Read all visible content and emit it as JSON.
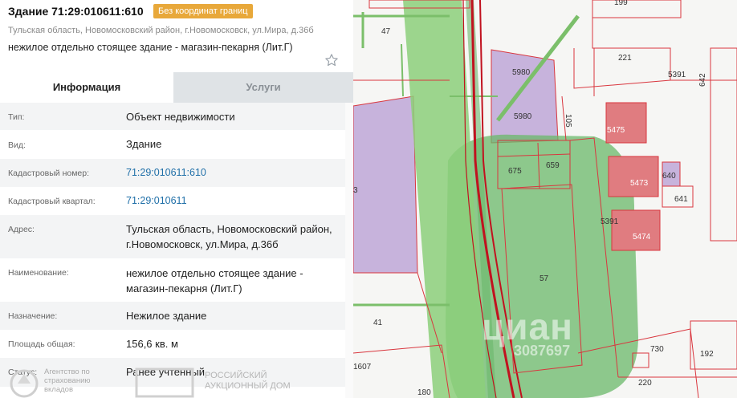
{
  "header": {
    "title": "Здание 71:29:010611:610",
    "badge": "Без координат границ",
    "address": "Тульская область, Новомосковский район, г.Новомосковск, ул.Мира, д.36б",
    "name": "нежилое отдельно стоящее здание - магазин-пекарня (Лит.Г)"
  },
  "tabs": [
    {
      "label": "Информация",
      "active": true
    },
    {
      "label": "Услуги",
      "active": false
    }
  ],
  "rows": [
    {
      "label": "Тип:",
      "value": "Объект недвижимости"
    },
    {
      "label": "Вид:",
      "value": "Здание"
    },
    {
      "label": "Кадастровый номер:",
      "value": "71:29:010611:610",
      "link": true
    },
    {
      "label": "Кадастровый квартал:",
      "value": "71:29:010611",
      "link": true
    },
    {
      "label": "Адрес:",
      "value": "Тульская область, Новомосковский район, г.Новомосковск, ул.Мира, д.36б"
    },
    {
      "label": "Наименование:",
      "value": "нежилое отдельно стоящее здание - магазин-пекарня (Лит.Г)"
    },
    {
      "label": "Назначение:",
      "value": "Нежилое здание"
    },
    {
      "label": "Площадь общая:",
      "value": "156,6 кв. м"
    },
    {
      "label": "Статус:",
      "value": "Ранее учтенный"
    }
  ],
  "watermarks": {
    "agency": "Агентство по страхованию вкладов",
    "auction": "РОССИЙСКИЙ АУКЦИОННЫЙ ДОМ",
    "cian": "циан",
    "cian_id": "3087697"
  },
  "map_labels": {
    "l199": "199",
    "l47": "47",
    "l221": "221",
    "l5391a": "5391",
    "l642": "642",
    "l5980a": "5980",
    "l5980b": "5980",
    "l105": "105",
    "l5475": "5475",
    "l675": "675",
    "l659": "659",
    "l5473": "5473",
    "l640": "640",
    "l641": "641",
    "l3": "3",
    "l5391b": "5391",
    "l5474": "5474",
    "l57": "57",
    "l41": "41",
    "l730": "730",
    "l192": "192",
    "l1607": "1607",
    "l220": "220",
    "l180": "180"
  },
  "colors": {
    "badge": "#e8a83a",
    "link": "#1f6fa8",
    "parcel_line": "#d9363e",
    "green_zone": "#6ab86a",
    "purple_parcel": "#c7b3dc",
    "red_building": "#e07c80"
  }
}
